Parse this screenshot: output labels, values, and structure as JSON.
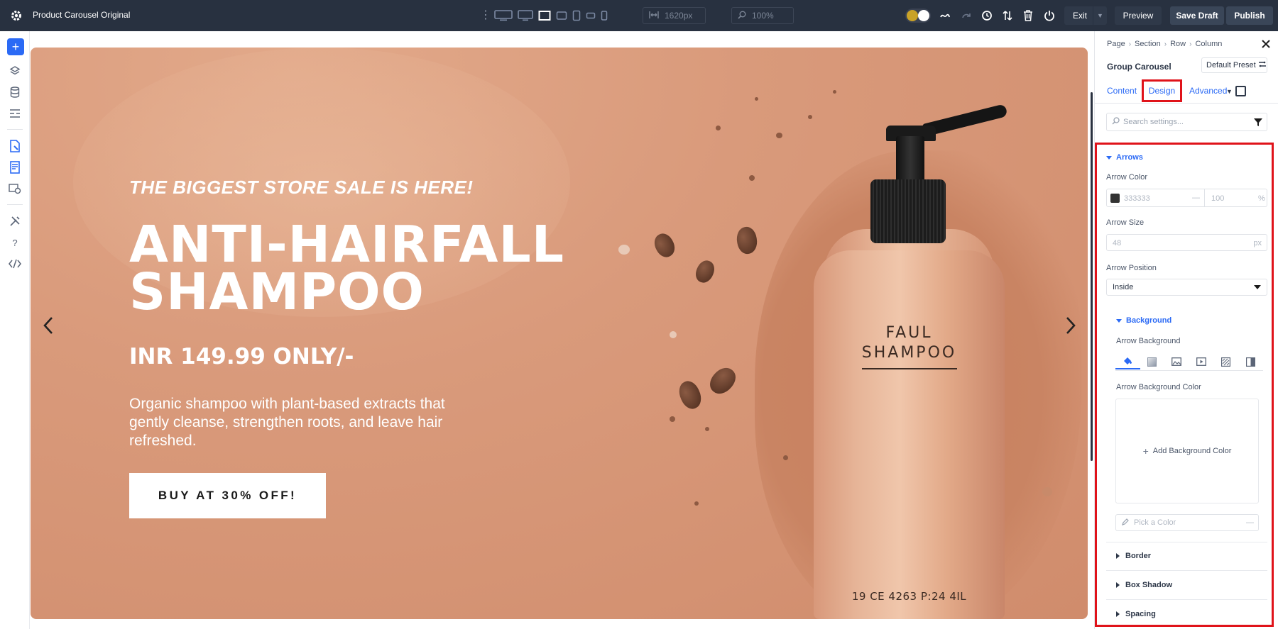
{
  "topbar": {
    "title": "Product Carousel Original",
    "width_value": "1620px",
    "zoom_value": "100%",
    "exit_label": "Exit",
    "preview_label": "Preview",
    "save_draft_label": "Save Draft",
    "publish_label": "Publish",
    "devices": [
      "desktop-wide-icon",
      "desktop-icon",
      "laptop-icon",
      "tablet-landscape-icon",
      "tablet-portrait-icon",
      "phone-landscape-icon",
      "phone-portrait-icon"
    ],
    "active_device": "laptop-icon"
  },
  "rail": {
    "icons": [
      "add-icon",
      "layers-icon",
      "database-icon",
      "layout-icon",
      "page-settings-icon",
      "theme-builder-icon",
      "portability-icon",
      "tools-icon",
      "help-icon",
      "code-icon"
    ]
  },
  "hero": {
    "tagline": "THE BIGGEST STORE SALE IS HERE!",
    "title_line1": "ANTI-HAIRFALL",
    "title_line2": "SHAMPOO",
    "price": "INR 149.99 ONLY/-",
    "description": "Organic shampoo with plant-based extracts that gently cleanse, strengthen roots, and leave hair refreshed.",
    "cta_label": "BUY AT 30% OFF!",
    "bottle_label_line1": "FAUL",
    "bottle_label_line2": "SHAMPOO",
    "bottle_code": "19 CE 4263 P:24 4IL",
    "background_color": "#d99a7b"
  },
  "panel": {
    "breadcrumb": [
      "Page",
      "Section",
      "Row",
      "Column"
    ],
    "module_name": "Group Carousel",
    "preset_label": "Default Preset",
    "tabs": {
      "content": "Content",
      "design": "Design",
      "advanced": "Advanced"
    },
    "active_tab": "Design",
    "search_placeholder": "Search settings...",
    "arrows": {
      "heading": "Arrows",
      "arrow_color_label": "Arrow Color",
      "arrow_color_value": "333333",
      "arrow_color_dash": "—",
      "arrow_opacity_value": "100",
      "arrow_opacity_unit": "%",
      "arrow_size_label": "Arrow Size",
      "arrow_size_value": "48",
      "arrow_size_unit": "px",
      "arrow_position_label": "Arrow Position",
      "arrow_position_value": "Inside"
    },
    "background": {
      "heading": "Background",
      "arrow_background_label": "Arrow Background",
      "arrow_background_color_label": "Arrow Background Color",
      "add_background_color_label": "Add Background Color",
      "pick_color_placeholder": "Pick a Color",
      "pick_color_dash": "—",
      "type_icons": [
        "paint-bucket-icon",
        "gradient-icon",
        "image-icon",
        "video-icon",
        "pattern-icon",
        "mask-icon"
      ]
    },
    "collapsed_sections": [
      "Border",
      "Box Shadow",
      "Spacing"
    ],
    "highlight_color": "#e0131a",
    "accent_color": "#2b6af5"
  }
}
